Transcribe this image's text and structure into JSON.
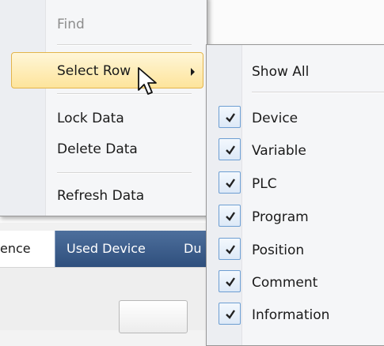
{
  "main_menu": {
    "find": "Find",
    "select_row": "Select Row",
    "lock_data": "Lock Data",
    "delete_data": "Delete Data",
    "refresh_data": "Refresh Data"
  },
  "submenu": {
    "show_all": "Show All",
    "items": [
      {
        "label": "Device",
        "checked": true
      },
      {
        "label": "Variable",
        "checked": true
      },
      {
        "label": "PLC",
        "checked": true
      },
      {
        "label": "Program",
        "checked": true
      },
      {
        "label": "Position",
        "checked": true
      },
      {
        "label": "Comment",
        "checked": true
      },
      {
        "label": "Information",
        "checked": true
      }
    ]
  },
  "tabs": [
    "ence",
    "Used Device",
    "Du"
  ],
  "colors": {
    "highlight_border": "#e3b44b",
    "highlight_fill": "#fde49b",
    "tabbar": "#2f4f7d",
    "check_border": "#6d9ed2"
  },
  "icons": {
    "checkmark": "check-icon",
    "submenu_arrow": "submenu-arrow-icon",
    "pointer": "mouse-pointer-icon"
  }
}
